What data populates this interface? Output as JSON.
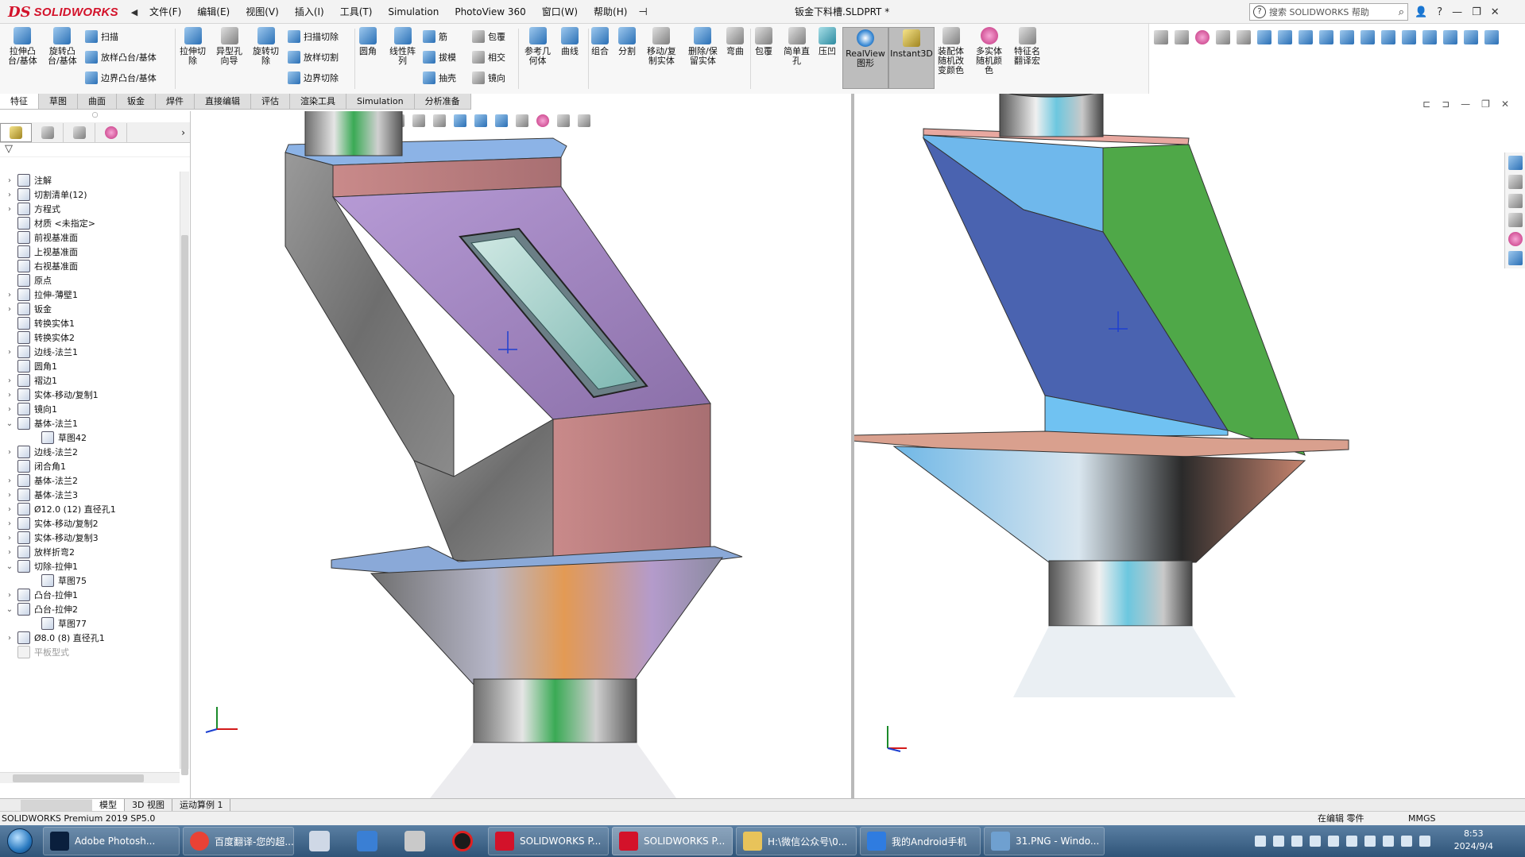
{
  "app": {
    "brand_ds": "DS",
    "brand": "SOLIDWORKS",
    "doc_title": "钣金下料槽.SLDPRT *",
    "help_search_placeholder": "搜索 SOLIDWORKS 帮助",
    "accent_color": "#d3122a"
  },
  "menu": [
    "文件(F)",
    "编辑(E)",
    "视图(V)",
    "插入(I)",
    "工具(T)",
    "Simulation",
    "PhotoView 360",
    "窗口(W)",
    "帮助(H)"
  ],
  "commands": {
    "extrude_boss": "拉伸凸\n台/基体",
    "revolve_boss": "旋转凸\n台/基体",
    "sweep": "扫描",
    "loft_boss": "放样凸台/基体",
    "boundary_boss": "边界凸台/基体",
    "extrude_cut": "拉伸切\n除",
    "hole_wizard": "异型孔\n向导",
    "revolve_cut": "旋转切\n除",
    "sweep_cut": "扫描切除",
    "loft_cut": "放样切割",
    "boundary_cut": "边界切除",
    "fillet": "圆角",
    "linear_pattern": "线性阵\n列",
    "rib": "筋",
    "draft": "拔模",
    "shell": "抽壳",
    "wrap": "包覆",
    "intersect": "相交",
    "mirror": "镜向",
    "ref_geometry": "参考几\n何体",
    "curves": "曲线",
    "combine": "组合",
    "split": "分割",
    "move_copy": "移动/复\n制实体",
    "delete_keep": "删除/保\n留实体",
    "flex": "弯曲",
    "wrap2": "包覆",
    "simple_hole": "简单直\n孔",
    "indent": "压凹",
    "realview": "RealView\n图形",
    "instant3d": "Instant3D",
    "assembly_color": "装配体\n随机改\n变颜色",
    "multibody_color": "多实体\n随机颜\n色",
    "feature_translate": "特征名\n翻译宏"
  },
  "tabs": [
    "特征",
    "草图",
    "曲面",
    "钣金",
    "焊件",
    "直接编辑",
    "评估",
    "渲染工具",
    "Simulation",
    "分析准备"
  ],
  "active_tab": "特征",
  "tree": [
    {
      "label": "注解",
      "expandable": true
    },
    {
      "label": "切割清单(12)",
      "expandable": true
    },
    {
      "label": "方程式",
      "expandable": true
    },
    {
      "label": "材质 <未指定>",
      "expandable": false
    },
    {
      "label": "前视基准面",
      "expandable": false
    },
    {
      "label": "上视基准面",
      "expandable": false
    },
    {
      "label": "右视基准面",
      "expandable": false
    },
    {
      "label": "原点",
      "expandable": false
    },
    {
      "label": "拉伸-薄壁1",
      "expandable": true
    },
    {
      "label": "钣金",
      "expandable": true
    },
    {
      "label": "转换实体1",
      "expandable": false
    },
    {
      "label": "转换实体2",
      "expandable": false
    },
    {
      "label": "边线-法兰1",
      "expandable": true
    },
    {
      "label": "圆角1",
      "expandable": false
    },
    {
      "label": "褶边1",
      "expandable": true
    },
    {
      "label": "实体-移动/复制1",
      "expandable": true
    },
    {
      "label": "镜向1",
      "expandable": true
    },
    {
      "label": "基体-法兰1",
      "expandable": true,
      "expanded": true
    },
    {
      "label": "草图42",
      "child": true
    },
    {
      "label": "边线-法兰2",
      "expandable": true
    },
    {
      "label": "闭合角1",
      "expandable": false
    },
    {
      "label": "基体-法兰2",
      "expandable": true
    },
    {
      "label": "基体-法兰3",
      "expandable": true
    },
    {
      "label": "Ø12.0 (12) 直径孔1",
      "expandable": true
    },
    {
      "label": "实体-移动/复制2",
      "expandable": true
    },
    {
      "label": "实体-移动/复制3",
      "expandable": true
    },
    {
      "label": "放样折弯2",
      "expandable": true
    },
    {
      "label": "切除-拉伸1",
      "expandable": true,
      "expanded": true
    },
    {
      "label": "草图75",
      "child": true
    },
    {
      "label": "凸台-拉伸1",
      "expandable": true
    },
    {
      "label": "凸台-拉伸2",
      "expandable": true,
      "expanded": true
    },
    {
      "label": "草图77",
      "child": true
    },
    {
      "label": "Ø8.0 (8) 直径孔1",
      "expandable": true
    },
    {
      "label": "平板型式",
      "expandable": false,
      "dim": true
    }
  ],
  "model_tabs": [
    "模型",
    "3D 视图",
    "运动算例 1"
  ],
  "status": {
    "product": "SOLIDWORKS Premium 2019 SP5.0",
    "editing": "在编辑 零件",
    "units": "MMGS"
  },
  "taskbar": {
    "items": [
      {
        "label": "Adobe Photosh...",
        "color": "#0a1f3d"
      },
      {
        "label": "百度翻译-您的超...",
        "color": "#e94235"
      },
      {
        "label": "SOLIDWORKS P...",
        "color": "#d3122a"
      },
      {
        "label": "SOLIDWORKS P...",
        "color": "#d3122a"
      },
      {
        "label": "H:\\微信公众号\\0...",
        "color": "#e8c35a"
      },
      {
        "label": "我的Android手机",
        "color": "#2f7ce0"
      },
      {
        "label": "31.PNG - Windo...",
        "color": "#6fa0d0"
      }
    ],
    "clock_time": "8:53",
    "clock_date": "2024/9/4"
  }
}
